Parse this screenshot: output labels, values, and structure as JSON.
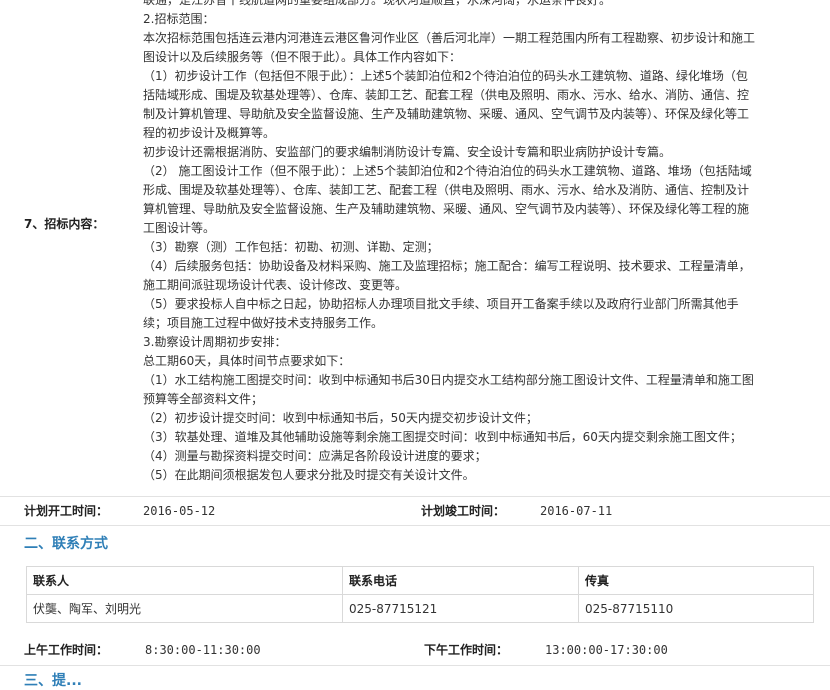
{
  "section7": {
    "label": "7、招标内容：",
    "lines": [
      "联通，是江苏省干线航道网的重要组成部分。现状河道顺直，水深河阔，水运条件良好。",
      "2.招标范围：",
      "本次招标范围包括连云港内河港连云港区鲁河作业区（善后河北岸）一期工程范围内所有工程勘察、初步设计和施工",
      "图设计以及后续服务等（但不限于此）。具体工作内容如下：",
      "（1）初步设计工作（包括但不限于此）：上述5个装卸泊位和2个待泊泊位的码头水工建筑物、道路、绿化堆场（包",
      "括陆域形成、围堤及软基处理等）、仓库、装卸工艺、配套工程（供电及照明、雨水、污水、给水、消防、通信、控",
      "制及计算机管理、导助航及安全监督设施、生产及辅助建筑物、采暖、通风、空气调节及内装等）、环保及绿化等工",
      "程的初步设计及概算等。",
      "初步设计还需根据消防、安监部门的要求编制消防设计专篇、安全设计专篇和职业病防护设计专篇。",
      "（2） 施工图设计工作（但不限于此）：上述5个装卸泊位和2个待泊泊位的码头水工建筑物、道路、堆场（包括陆域",
      "形成、围堤及软基处理等）、仓库、装卸工艺、配套工程（供电及照明、雨水、污水、给水及消防、通信、控制及计",
      "算机管理、导助航及安全监督设施、生产及辅助建筑物、采暖、通风、空气调节及内装等）、环保及绿化等工程的施",
      "工图设计等。",
      "（3）勘察（测）工作包括：初勘、初测、详勘、定测；",
      "（4）后续服务包括：协助设备及材料采购、施工及监理招标；施工配合：编写工程说明、技术要求、工程量清单，",
      "施工期间派驻现场设计代表、设计修改、变更等。",
      "（5）要求投标人自中标之日起，协助招标人办理项目批文手续、项目开工备案手续以及政府行业部门所需其他手",
      "续；项目施工过程中做好技术支持服务工作。",
      "3.勘察设计周期初步安排：",
      "总工期60天，具体时间节点要求如下：",
      "（1）水工结构施工图提交时间：收到中标通知书后30日内提交水工结构部分施工图设计文件、工程量清单和施工图",
      "预算等全部资料文件；",
      "（2）初步设计提交时间：收到中标通知书后，50天内提交初步设计文件；",
      "（3）软基处理、道堆及其他辅助设施等剩余施工图提交时间：收到中标通知书后，60天内提交剩余施工图文件；",
      "（4）测量与勘探资料提交时间：应满足各阶段设计进度的要求；",
      "（5）在此期间须根据发包人要求分批及时提交有关设计文件。"
    ]
  },
  "plan": {
    "start_label": "计划开工时间：",
    "start_value": "2016-05-12",
    "end_label": "计划竣工时间：",
    "end_value": "2016-07-11"
  },
  "contact": {
    "title": "二、联系方式",
    "headers": [
      "联系人",
      "联系电话",
      "传真"
    ],
    "row": [
      "伏龑、陶军、刘明光",
      "025-87715121",
      "025-87715110"
    ]
  },
  "work_hours": {
    "am_label": "上午工作时间：",
    "am_value": "8:30:00-11:30:00",
    "pm_label": "下午工作时间：",
    "pm_value": "13:00:00-17:30:00"
  },
  "next_section": {
    "title": "三、提..."
  }
}
